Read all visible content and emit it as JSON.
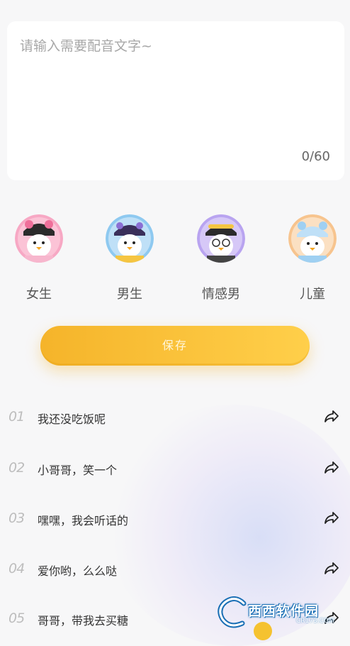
{
  "editor": {
    "placeholder": "请输入需要配音文字~",
    "counter": "0/60"
  },
  "voices": [
    {
      "label": "女生",
      "color": "#f7a8c4"
    },
    {
      "label": "男生",
      "color": "#8ec9f0"
    },
    {
      "label": "情感男",
      "color": "#b9a4f0"
    },
    {
      "label": "儿童",
      "color": "#f7c48e"
    }
  ],
  "save_button": {
    "label": "保存"
  },
  "phrases": [
    {
      "num": "01",
      "text": "我还没吃饭呢"
    },
    {
      "num": "02",
      "text": "小哥哥，笑一个"
    },
    {
      "num": "03",
      "text": "嘿嘿，我会听话的"
    },
    {
      "num": "04",
      "text": "爱你哟，么么哒"
    },
    {
      "num": "05",
      "text": "哥哥，带我去买糖"
    }
  ],
  "watermark": {
    "text": "西西软件园",
    "sub": "CR173.COM"
  },
  "colors": {
    "accent": "#f5b42a",
    "background": "#f7f7f8"
  }
}
